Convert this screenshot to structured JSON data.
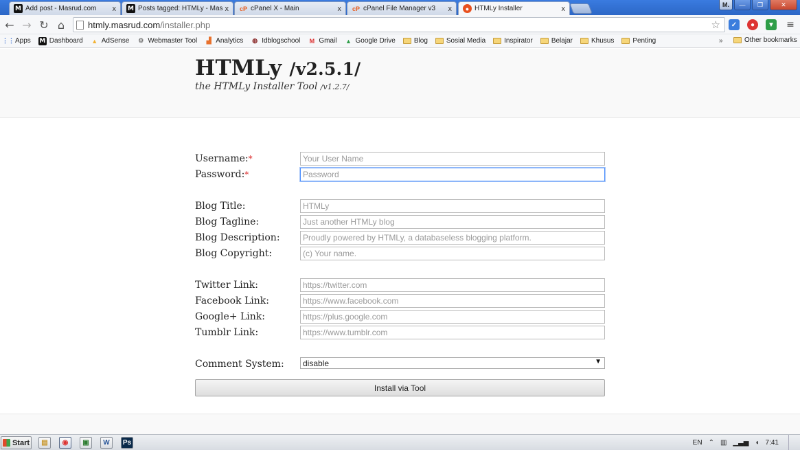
{
  "browser": {
    "tabs": [
      {
        "title": "Add post - Masrud.com",
        "favicon": "m-icon"
      },
      {
        "title": "Posts tagged: HTMLy - Masr",
        "favicon": "m-icon"
      },
      {
        "title": "cPanel X - Main",
        "favicon": "cpanel-icon"
      },
      {
        "title": "cPanel File Manager v3",
        "favicon": "cpanel-icon"
      },
      {
        "title": "HTMLy Installer",
        "favicon": "htmly-icon",
        "active": true
      }
    ],
    "close_glyph": "x",
    "user_initial": "M.",
    "address": {
      "host": "htmly.masrud.com",
      "path": "/installer.php"
    },
    "bookmarks": {
      "apps": "Apps",
      "items": [
        {
          "label": "Dashboard",
          "icon": "m-icon"
        },
        {
          "label": "AdSense",
          "icon": "adsense-icon"
        },
        {
          "label": "Webmaster Tool",
          "icon": "webmaster-icon"
        },
        {
          "label": "Analytics",
          "icon": "analytics-icon"
        },
        {
          "label": "Idblogschool",
          "icon": "idblogschool-icon"
        },
        {
          "label": "Gmail",
          "icon": "gmail-icon"
        },
        {
          "label": "Google Drive",
          "icon": "drive-icon"
        },
        {
          "label": "Blog",
          "icon": "folder-icon"
        },
        {
          "label": "Sosial Media",
          "icon": "folder-icon"
        },
        {
          "label": "Inspirator",
          "icon": "folder-icon"
        },
        {
          "label": "Belajar",
          "icon": "folder-icon"
        },
        {
          "label": "Khusus",
          "icon": "folder-icon"
        },
        {
          "label": "Penting",
          "icon": "folder-icon"
        }
      ],
      "more": "»",
      "other": "Other bookmarks"
    }
  },
  "page": {
    "title": "HTMLy",
    "version": "/v2.5.1/",
    "subtitle": "the HTMLy Installer Tool",
    "subversion": "/v1.2.7/",
    "required_mark": "*",
    "fields": {
      "username": {
        "label": "Username:",
        "placeholder": "Your User Name"
      },
      "password": {
        "label": "Password:",
        "placeholder": "Password"
      },
      "blog_title": {
        "label": "Blog Title:",
        "placeholder": "HTMLy"
      },
      "blog_tagline": {
        "label": "Blog Tagline:",
        "placeholder": "Just another HTMLy blog"
      },
      "blog_description": {
        "label": "Blog Description:",
        "placeholder": "Proudly powered by HTMLy, a databaseless blogging platform."
      },
      "blog_copyright": {
        "label": "Blog Copyright:",
        "placeholder": "(c) Your name."
      },
      "twitter": {
        "label": "Twitter Link:",
        "placeholder": "https://twitter.com"
      },
      "facebook": {
        "label": "Facebook Link:",
        "placeholder": "https://www.facebook.com"
      },
      "google": {
        "label": "Google+ Link:",
        "placeholder": "https://plus.google.com"
      },
      "tumblr": {
        "label": "Tumblr Link:",
        "placeholder": "https://www.tumblr.com"
      },
      "comment_system": {
        "label": "Comment System:",
        "value": "disable"
      }
    },
    "install_button": "Install via Tool"
  },
  "taskbar": {
    "start": "Start",
    "language": "EN",
    "clock": "7:41"
  }
}
